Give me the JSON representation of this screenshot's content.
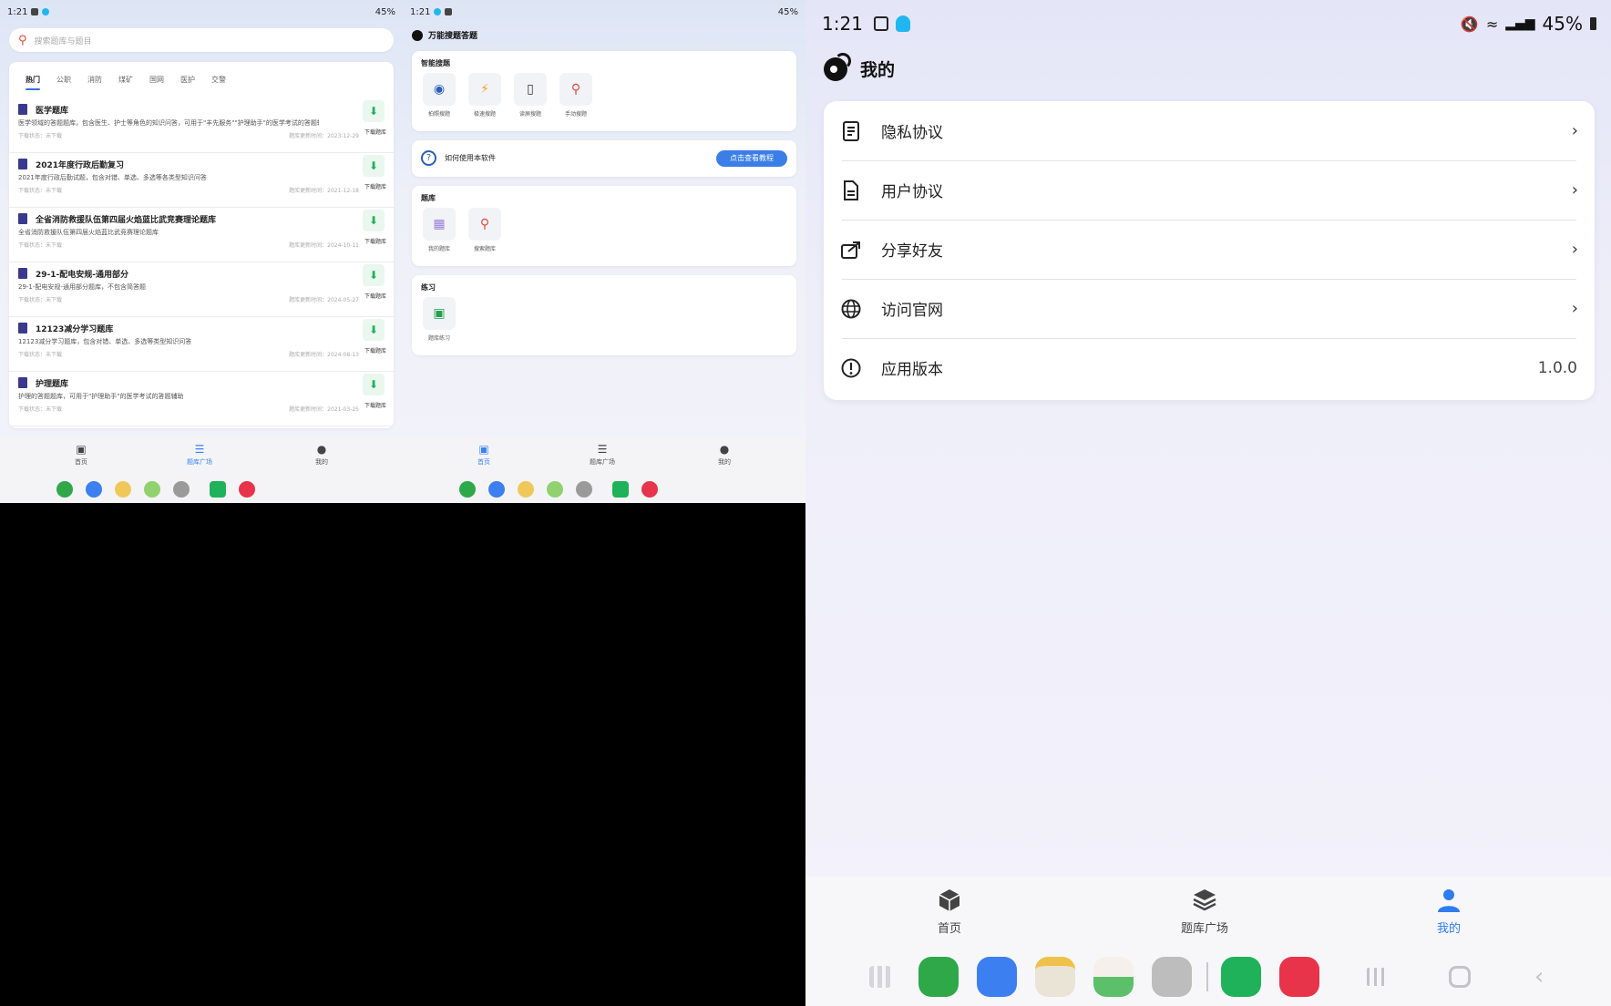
{
  "left_panel": {
    "status": {
      "time": "1:21",
      "battery": "45%"
    },
    "search_placeholder": "搜索题库与题目",
    "tabs": [
      "热门",
      "公职",
      "消防",
      "煤矿",
      "国网",
      "医护",
      "交警"
    ],
    "banks": [
      {
        "title": "医学题库",
        "desc": "医学领域的答题题库，包含医生、护士等角色的知识问答，可用于\"丰先服务\"\"护理助手\"的医学考试的答题辅助",
        "status": "下载状态：未下载",
        "updated": "题库更新时间：2023-12-29"
      },
      {
        "title": "2021年度行政后勤复习",
        "desc": "2021年度行政后勤试题，包含对错、单选、多选等各类型知识问答",
        "status": "下载状态：未下载",
        "updated": "题库更新时间：2021-12-18"
      },
      {
        "title": "全省消防救援队伍第四届火焰蓝比武竞赛理论题库",
        "desc": "全省消防救援队伍第四届火焰蓝比武竞赛理论题库",
        "status": "下载状态：未下载",
        "updated": "题库更新时间：2024-10-11"
      },
      {
        "title": "29-1-配电安规-通用部分",
        "desc": "29-1-配电安规-通用部分题库，不包含简答题",
        "status": "下载状态：未下载",
        "updated": "题库更新时间：2024-05-27"
      },
      {
        "title": "12123减分学习题库",
        "desc": "12123减分学习题库，包含对错、单选、多选等类型知识问答",
        "status": "下载状态：未下载",
        "updated": "题库更新时间：2024-08-13"
      },
      {
        "title": "护理题库",
        "desc": "护理的答题题库，可用于\"护理助手\"的医学考试的答题辅助",
        "status": "下载状态：未下载",
        "updated": "题库更新时间：2021-03-25"
      }
    ],
    "download_label": "下载题库",
    "nav": [
      {
        "label": "首页"
      },
      {
        "label": "题库广场"
      },
      {
        "label": "我的"
      }
    ]
  },
  "middle_panel": {
    "status": {
      "time": "1:21",
      "battery": "45%"
    },
    "app_title": "万能搜题答题",
    "smart_section": {
      "title": "智能搜题",
      "tiles": [
        "拍照搜题",
        "极速搜题",
        "读屏搜题",
        "手动搜题"
      ]
    },
    "help": {
      "text": "如何使用本软件",
      "button": "点击查看教程"
    },
    "bank_section": {
      "title": "题库",
      "tiles": [
        "我的题库",
        "搜索题库"
      ]
    },
    "practice_section": {
      "title": "练习",
      "tiles": [
        "题库练习"
      ]
    },
    "nav": [
      {
        "label": "首页"
      },
      {
        "label": "题库广场"
      },
      {
        "label": "我的"
      }
    ]
  },
  "right_panel": {
    "status": {
      "time": "1:21",
      "battery": "45%"
    },
    "page_title": "我的",
    "menu": [
      {
        "label": "隐私协议",
        "icon": "document-icon"
      },
      {
        "label": "用户协议",
        "icon": "document-icon"
      },
      {
        "label": "分享好友",
        "icon": "share-icon"
      },
      {
        "label": "访问官网",
        "icon": "globe-icon"
      },
      {
        "label": "应用版本",
        "icon": "info-icon",
        "value": "1.0.0"
      }
    ],
    "nav": [
      {
        "label": "首页"
      },
      {
        "label": "题库广场"
      },
      {
        "label": "我的"
      }
    ]
  },
  "colors": {
    "accent": "#2f7cf0",
    "download_green": "#1db25a",
    "search_red": "#e24a3b"
  }
}
